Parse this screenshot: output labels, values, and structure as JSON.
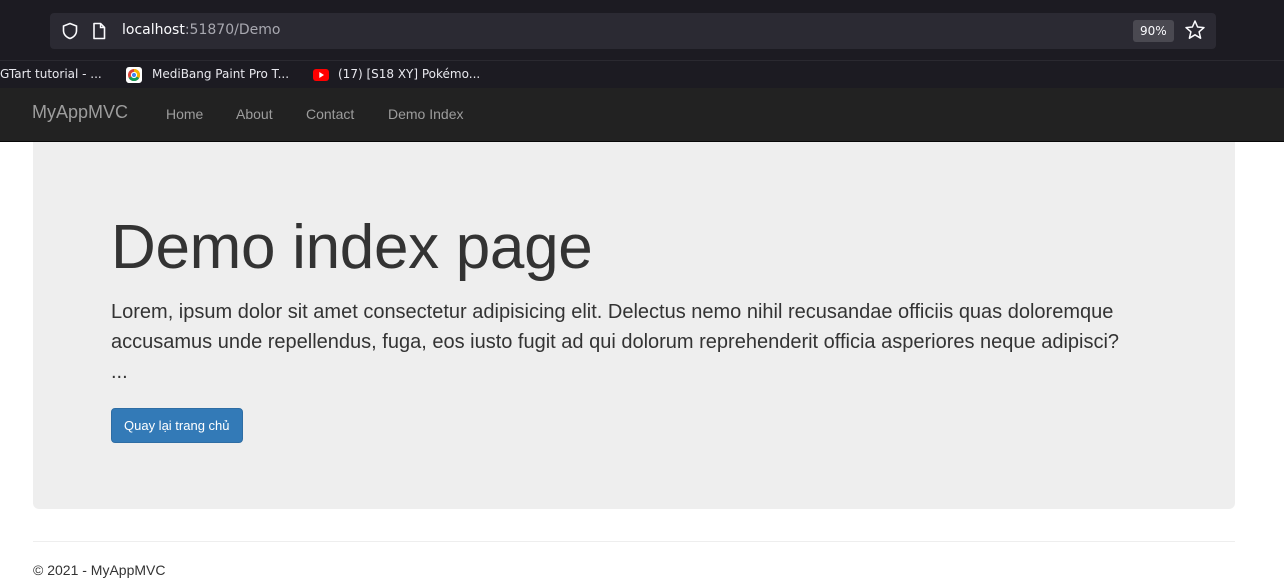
{
  "browser": {
    "url_host": "localhost",
    "url_rest": ":51870/Demo",
    "zoom": "90%",
    "bookmarks": [
      {
        "label": "GTart tutorial - ...",
        "icon": ""
      },
      {
        "label": "MediBang Paint Pro T...",
        "icon": "chrome-favicon-icon"
      },
      {
        "label": "(17) [S18 XY] Pokémo...",
        "icon": "youtube-favicon-icon"
      }
    ]
  },
  "navbar": {
    "brand": "MyAppMVC",
    "links": [
      "Home",
      "About",
      "Contact",
      "Demo Index"
    ]
  },
  "jumbotron": {
    "title": "Demo index page",
    "lead": "Lorem, ipsum dolor sit amet consectetur adipisicing elit. Delectus nemo nihil recusandae officiis quas doloremque accusamus unde repellendus, fuga, eos iusto fugit ad qui dolorum reprehenderit officia asperiores neque adipisci? ...",
    "button_label": "Quay lại trang chủ"
  },
  "footer": {
    "text": "© 2021 - MyAppMVC"
  },
  "colors": {
    "navbar_bg": "#222222",
    "jumbotron_bg": "#eeeeee",
    "primary_button": "#337ab7",
    "browser_chrome": "#1c1b22"
  }
}
